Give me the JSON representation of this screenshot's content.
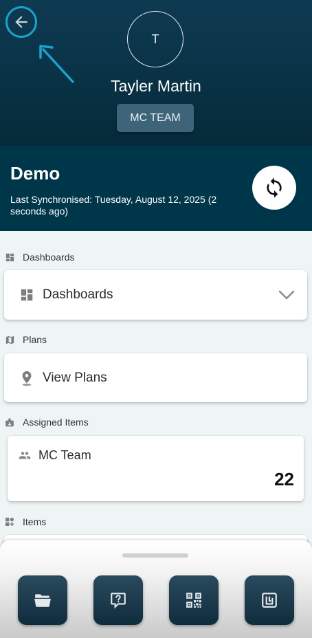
{
  "header": {
    "avatar_initial": "T",
    "user_name": "Tayler Martin",
    "team_badge": "MC TEAM"
  },
  "sync": {
    "title": "Demo",
    "last_synced": "Last Synchronised: Tuesday, August 12, 2025 (2 seconds ago)"
  },
  "sections": {
    "dashboards": {
      "label": "Dashboards",
      "card_label": "Dashboards"
    },
    "plans": {
      "label": "Plans",
      "card_label": "View Plans"
    },
    "assigned": {
      "label": "Assigned Items",
      "card_title": "MC Team",
      "count": "22"
    },
    "items": {
      "label": "Items"
    }
  },
  "icons": {
    "back": "arrow-left-icon",
    "sync": "sync-icon",
    "dashboard": "dashboard-icon",
    "map": "map-icon",
    "location": "location-pin-icon",
    "badge": "badge-icon",
    "people": "people-icon",
    "items": "widgets-icon",
    "folder": "folder-icon",
    "help": "help-chat-icon",
    "qr": "qr-code-icon",
    "nfc": "nfc-icon"
  },
  "colors": {
    "header_bg": "#0e3a52",
    "banner_bg": "#003649",
    "accent_annotation": "#1aa3cc",
    "badge_bg": "#3d6479",
    "fab_bg": "#1e3d50"
  }
}
